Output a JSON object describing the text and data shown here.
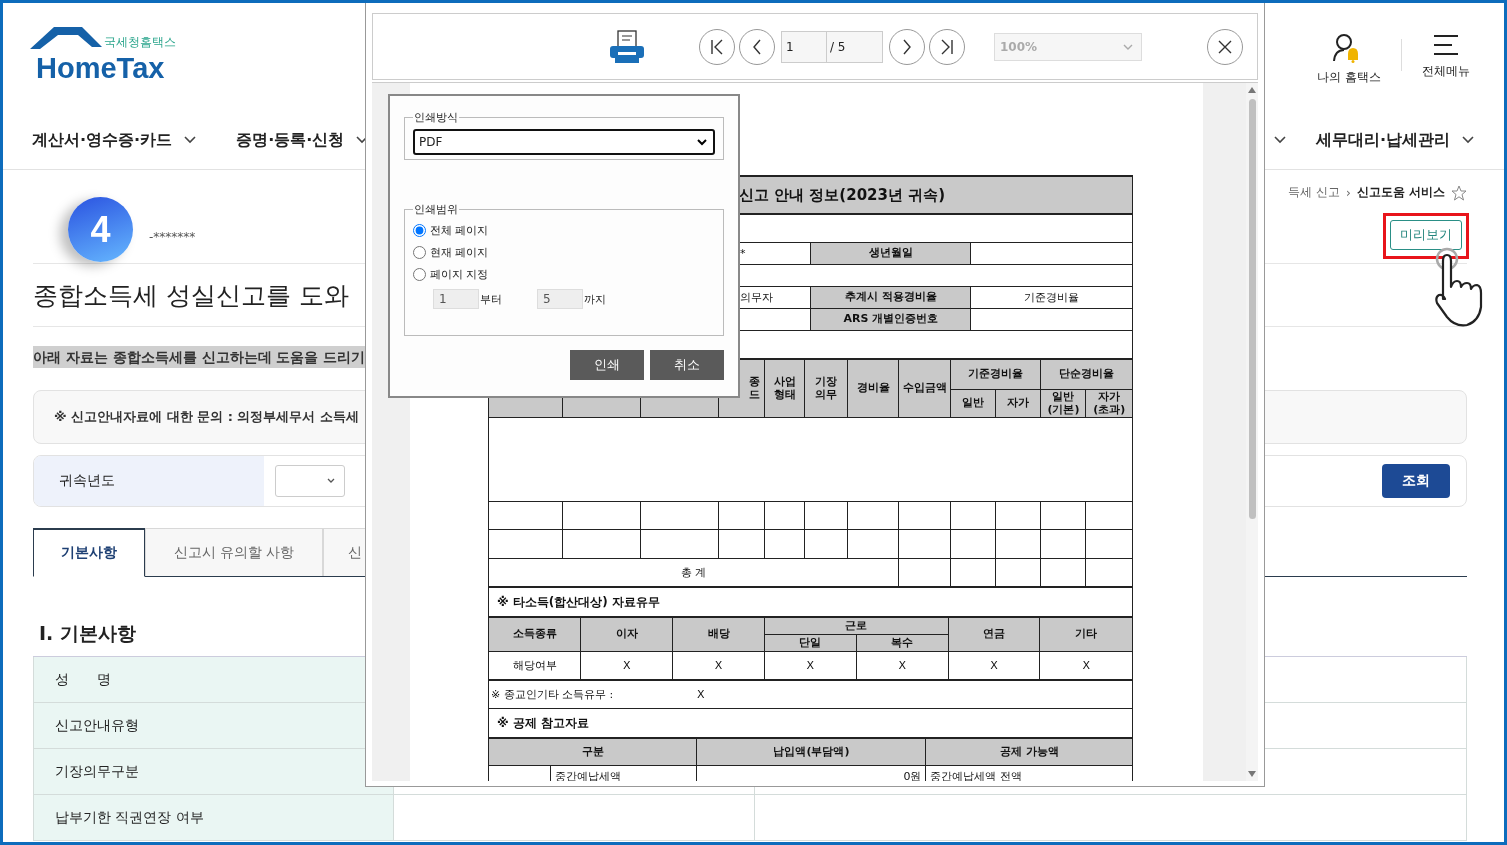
{
  "logo": {
    "subtitle": "국세청홈택스",
    "name": "HomeTax"
  },
  "header_links": [
    {
      "label": "나의 홈택스",
      "kind": "user"
    },
    {
      "label": "전체메뉴",
      "kind": "menu"
    }
  ],
  "nav": [
    {
      "label": "계산서·영수증·카드"
    },
    {
      "label": "증명·등록·신청"
    },
    {
      "label": "세무대리·납세관리"
    }
  ],
  "breadcrumb": {
    "items": [
      "득세 신고",
      "신고도움 서비스"
    ],
    "separator": "›",
    "favorite": false
  },
  "profile": {
    "badge": "4",
    "masked_name": "-*******"
  },
  "preview_button": "미리보기",
  "page_title": "종합소득세 성실신고를 도와",
  "notice": "아래 자료는 종합소득세를 신고하는데 도움을 드리기",
  "inquiry": "※ 신고안내자료에 대한 문의 : 의정부세무서 소득세",
  "year_filter": {
    "label": "귀속년도",
    "button": "조회"
  },
  "tabs": [
    {
      "label": "기본사항",
      "selected": true
    },
    {
      "label": "신고시 유의할 사항",
      "selected": false
    },
    {
      "label": "신",
      "selected": false
    }
  ],
  "section_title": "Ⅰ. 기본사항",
  "basic_rows": [
    "성　　명",
    "신고안내유형",
    "기장의무구분",
    "납부기한 직권연장 여부"
  ],
  "viewer": {
    "page": "1",
    "page_total": "/ 5",
    "zoom": "100%",
    "document": {
      "title": "신고 안내 정보(2023년 귀속)",
      "info_rows": [
        {
          "kind": "blank"
        },
        {
          "kind": "pair",
          "fragment": "*",
          "label": "생년월일"
        },
        {
          "kind": "blank"
        },
        {
          "kind": "pair",
          "fragment": "의무자",
          "label": "추계시 적용경비율",
          "value": "기준경비율"
        },
        {
          "kind": "pair",
          "label": "ARS 개별인증번호"
        },
        {
          "kind": "blank"
        }
      ],
      "income_headers": [
        [
          "종",
          "드"
        ],
        [
          "사업",
          "형태"
        ],
        [
          "기장",
          "의무"
        ],
        [
          "경비율"
        ],
        [
          "수입금액"
        ]
      ],
      "income_groups": [
        {
          "label": "기준경비율",
          "sub": [
            [
              "일반"
            ],
            [
              "자가"
            ]
          ]
        },
        {
          "label": "단순경비율",
          "sub": [
            [
              "일반",
              "(기본)"
            ],
            [
              "자가",
              "(초과)"
            ]
          ]
        }
      ],
      "total_label": "총 계",
      "other_income": {
        "title": "※ 타소득(합산대상) 자료유무",
        "first_header": "소득종류",
        "headers_before": [
          "이자",
          "배당"
        ],
        "group": {
          "label": "근로",
          "sub": [
            "단일",
            "복수"
          ]
        },
        "headers_after": [
          "연금",
          "기타"
        ],
        "row_label": "해당여부",
        "marks": [
          "X",
          "X",
          "X",
          "X",
          "X",
          "X"
        ]
      },
      "religious_note": {
        "label": "※ 종교인기타 소득유무 :",
        "mark": "X"
      },
      "deduction": {
        "title": "※ 공제 참고자료",
        "headers": [
          "구분",
          "납입액(부담액)",
          "공제 가능액"
        ],
        "row": {
          "item": "중간예납세액",
          "amount": "0원",
          "deductible": "중간예납세액 전액"
        }
      }
    }
  },
  "print_dialog": {
    "method_legend": "인쇄방식",
    "method": "PDF",
    "range_legend": "인쇄범위",
    "range_options": [
      {
        "label": "전체 페이지",
        "selected": true
      },
      {
        "label": "현재 페이지",
        "selected": false
      },
      {
        "label": "페이지 지정",
        "selected": false
      }
    ],
    "range_from": "1",
    "from_label": "부터",
    "range_to": "5",
    "to_label": "까지",
    "buttons": [
      "인쇄",
      "취소"
    ]
  }
}
